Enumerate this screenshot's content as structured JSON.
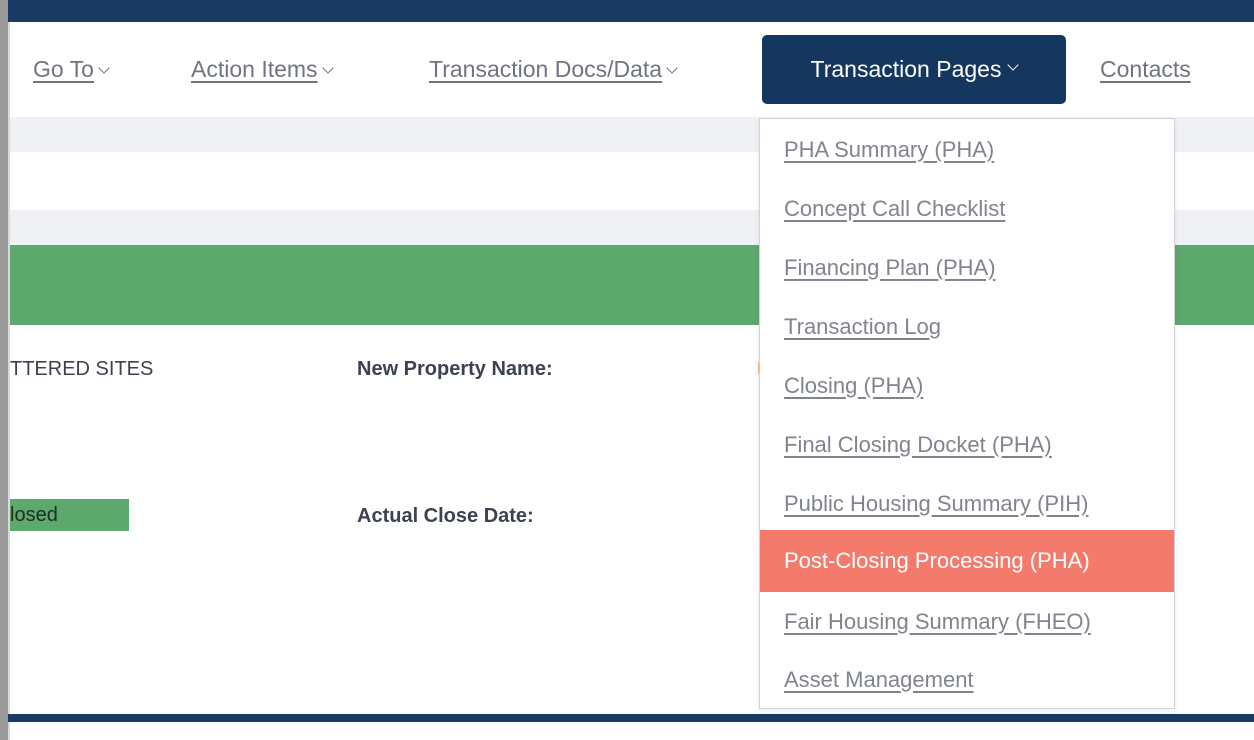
{
  "nav": {
    "goto_label": "Go To",
    "action_items_label": "Action Items",
    "transaction_docs_label": "Transaction Docs/Data",
    "transaction_pages_label": "Transaction Pages",
    "contacts_label": "Contacts"
  },
  "dropdown": {
    "items": [
      {
        "label": "PHA Summary (PHA)"
      },
      {
        "label": "Concept Call Checklist"
      },
      {
        "label": "Financing Plan (PHA)"
      },
      {
        "label": "Transaction Log"
      },
      {
        "label": "Closing (PHA)"
      },
      {
        "label": "Final Closing Docket (PHA)"
      },
      {
        "label": "Public Housing Summary (PIH)"
      },
      {
        "label": "Post-Closing Processing (PHA)"
      },
      {
        "label": "Fair Housing Summary (FHEO)"
      },
      {
        "label": "Asset Management"
      }
    ],
    "highlighted_index": 7
  },
  "details": {
    "site_value": "TTERED SITES",
    "new_property_name_label": "New Property Name:",
    "status_value": "losed",
    "actual_close_date_label": "Actual Close Date:"
  },
  "colors": {
    "nav_bar": "#1a3a63",
    "active_tab": "#15365e",
    "green_band": "#5da86c",
    "highlight": "#f47b6c"
  }
}
